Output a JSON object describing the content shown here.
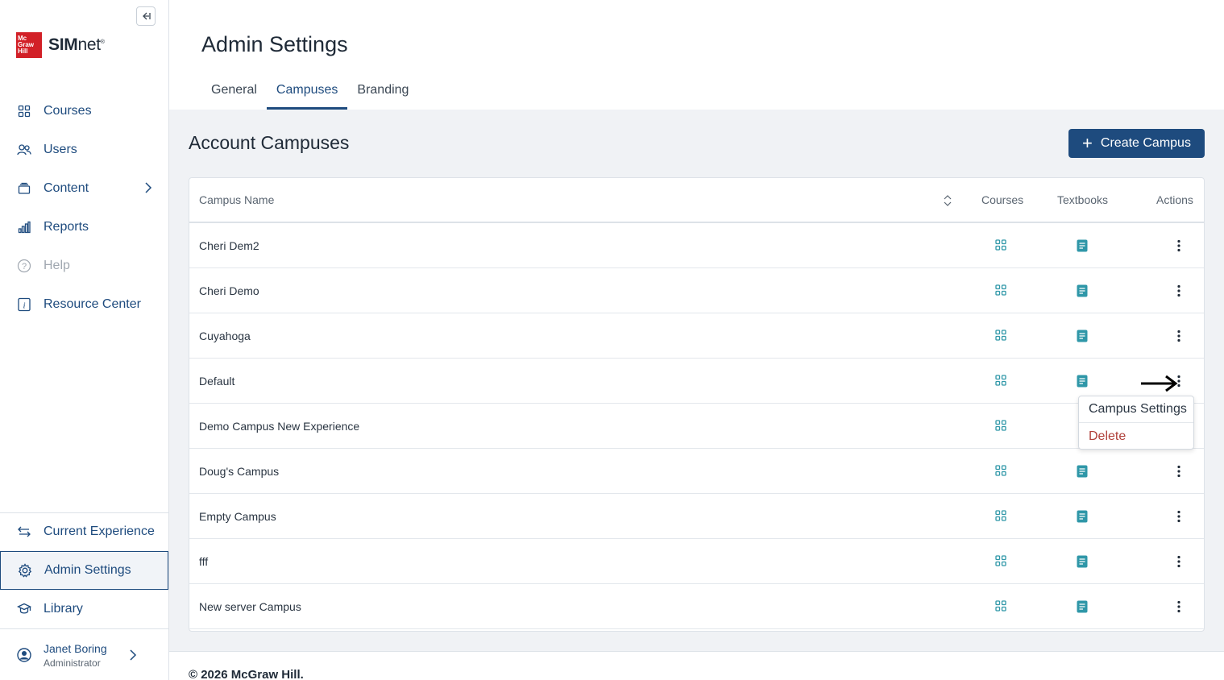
{
  "brand": {
    "logo_line1": "Mc",
    "logo_line2": "Graw",
    "logo_line3": "Hill",
    "name_bold": "SIM",
    "name_rest": "net",
    "trademark": "®"
  },
  "sidebar": {
    "items": [
      {
        "label": "Courses",
        "icon": "grid-icon"
      },
      {
        "label": "Users",
        "icon": "users-icon"
      },
      {
        "label": "Content",
        "icon": "folder-icon"
      },
      {
        "label": "Reports",
        "icon": "bar-chart-icon"
      },
      {
        "label": "Help",
        "icon": "help-icon"
      },
      {
        "label": "Resource Center",
        "icon": "info-icon"
      }
    ],
    "bottom_items": [
      {
        "label": "Current Experience",
        "icon": "swap-icon"
      },
      {
        "label": "Admin Settings",
        "icon": "gear-icon"
      },
      {
        "label": "Library",
        "icon": "graduation-cap-icon"
      }
    ],
    "user": {
      "name": "Janet Boring",
      "role": "Administrator"
    }
  },
  "header": {
    "title": "Admin Settings",
    "tabs": [
      {
        "label": "General"
      },
      {
        "label": "Campuses"
      },
      {
        "label": "Branding"
      }
    ],
    "active_tab": "Campuses"
  },
  "section": {
    "title": "Account Campuses",
    "create_label": "Create Campus"
  },
  "table": {
    "headers": {
      "name": "Campus Name",
      "courses": "Courses",
      "textbooks": "Textbooks",
      "actions": "Actions"
    },
    "rows": [
      {
        "name": "Cheri Dem2"
      },
      {
        "name": "Cheri Demo"
      },
      {
        "name": "Cuyahoga"
      },
      {
        "name": "Default"
      },
      {
        "name": "Demo Campus New Experience"
      },
      {
        "name": "Doug's Campus"
      },
      {
        "name": "Empty Campus"
      },
      {
        "name": "fff"
      },
      {
        "name": "New server Campus"
      }
    ]
  },
  "dropdown": {
    "settings_label": "Campus Settings",
    "delete_label": "Delete"
  },
  "footer": {
    "copyright": "© 2026 McGraw Hill."
  },
  "colors": {
    "primary": "#1e4b7e",
    "teal": "#2f97a8",
    "delete": "#b0403a",
    "logo_red": "#d22027"
  }
}
